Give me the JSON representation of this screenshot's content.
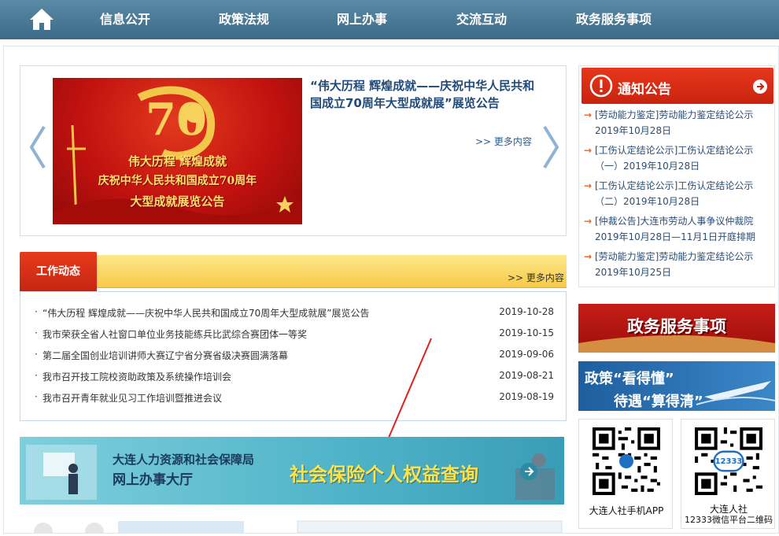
{
  "nav": {
    "items": [
      "信息公开",
      "政策法规",
      "网上办事",
      "交流互动",
      "政务服务事项"
    ]
  },
  "banner": {
    "image_lines": [
      "伟大历程  辉煌成就",
      "庆祝中华人民共和国成立70周年",
      "大型成就展览公告"
    ],
    "title": "“伟大历程  辉煌成就——庆祝中华人民共和国成立70周年大型成就展”展览公告",
    "more": ">> 更多内容"
  },
  "news": {
    "tab": "工作动态",
    "more": ">> 更多内容",
    "items": [
      {
        "title": "“伟大历程  辉煌成就——庆祝中华人民共和国成立70周年大型成就展”展览公告",
        "date": "2019-10-28"
      },
      {
        "title": "我市荣获全省人社窗口单位业务技能练兵比武综合赛团体一等奖",
        "date": "2019-10-15"
      },
      {
        "title": "第二届全国创业培训讲师大赛辽宁省分赛省级决赛圆满落幕",
        "date": "2019-09-06"
      },
      {
        "title": "我市召开技工院校资助政策及系统操作培训会",
        "date": "2019-08-21"
      },
      {
        "title": "我市召开青年就业见习工作培训暨推进会议",
        "date": "2019-08-19"
      }
    ]
  },
  "hall": {
    "org": "大连人力资源和社会保障局",
    "name": "网上办事大厅",
    "query": "社会保险个人权益查询"
  },
  "notice": {
    "title": "通知公告",
    "items": [
      "[劳动能力鉴定]劳动能力鉴定结论公示2019年10月28日",
      "[工伤认定结论公示]工伤认定结论公示（一）2019年10月28日",
      "[工伤认定结论公示]工伤认定结论公示（二）2019年10月28日",
      "[仲裁公告]大连市劳动人事争议仲裁院2019年10月28日—11月1日开庭排期",
      "[劳动能力鉴定]劳动能力鉴定结论公示2019年10月25日"
    ]
  },
  "side": {
    "service": "政务服务事项",
    "policy_l1": "政策“看得懂”",
    "policy_l2": "待遇“算得清”"
  },
  "qr": {
    "app_label": "大连人社手机APP",
    "wechat_l1": "大连人社",
    "wechat_l2": "12333微信平台二维码",
    "badge": "12333"
  },
  "colors": {
    "nav": "#3a6a87",
    "accent_red": "#c9240f",
    "link": "#2a4d75"
  }
}
